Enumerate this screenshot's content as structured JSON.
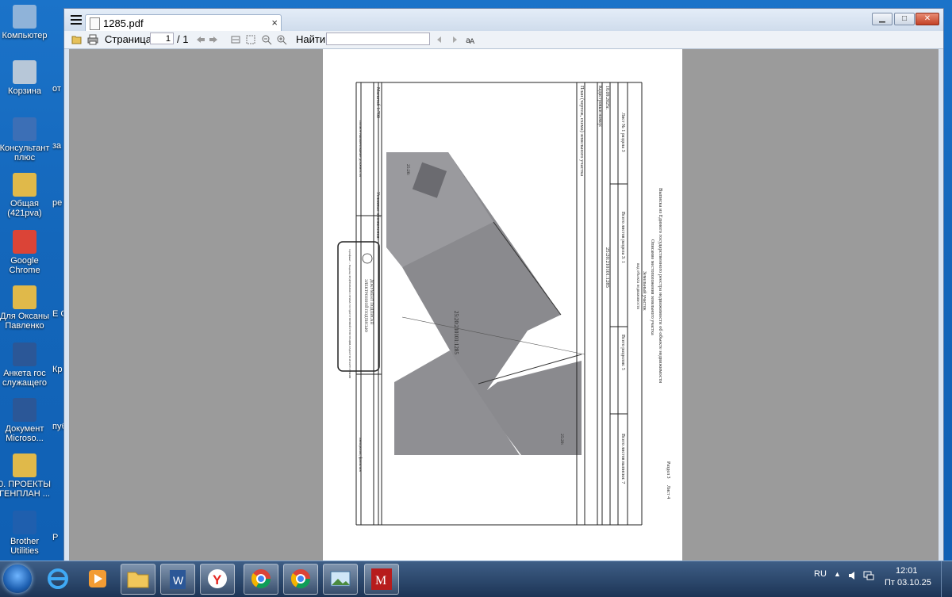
{
  "desktop": {
    "icons": [
      {
        "label": "Компьютер",
        "color": "#8fb3d9"
      },
      {
        "label": "Корзина",
        "color": "#b7c7d8"
      },
      {
        "label": "Консультант плюс",
        "color": "#3c6fb6"
      },
      {
        "label": "Общая (421pva)",
        "color": "#e0b94a"
      },
      {
        "label": "Google Chrome",
        "color": "#db4437"
      },
      {
        "label": "Для Оксаны Павленко",
        "color": "#e0b94a"
      },
      {
        "label": "Анкета гос служащего",
        "color": "#2b5797"
      },
      {
        "label": "Документ Microsо...",
        "color": "#2b5797"
      },
      {
        "label": "0. ПРОЕКТЫ ГЕНПЛАН ...",
        "color": "#e0b94a"
      },
      {
        "label": "Brother Utilities",
        "color": "#1f5fae"
      }
    ],
    "cut_labels": [
      "от",
      "за",
      "ре утв",
      "Е С",
      "Кр",
      "пуб",
      "Р"
    ]
  },
  "window": {
    "menu_icon": "hamburger-icon",
    "tab_title": "1285.pdf",
    "tab_close": "×",
    "minimize": "▁",
    "maximize": "□",
    "close": "✕"
  },
  "toolbar": {
    "page_label": "Страница:",
    "page_current": "1",
    "page_total": "/ 1",
    "find_label": "Найти:",
    "find_value": ""
  },
  "document": {
    "header_line1": "Выписка из Единого государственного реестра недвижимости об объекте недвижимости",
    "header_line2": "Описание местоположения земельного участка",
    "object_type": "Земельный участок",
    "object_type_caption": "вид объекта недвижимости",
    "section_label": "Раздел 3",
    "sheet_label": "Лист 4",
    "cell_sheet_no": "Лист № 1 раздела 3",
    "cell_total_sheets_section": "Всего листов раздела 3: 1",
    "cell_total_sections": "Всего разделов: 5",
    "cell_total_sheets_extract": "Всего листов выписки: 7",
    "date": "18.09.2025г.",
    "cad_label": "Кадастровый номер:",
    "cad_number": "25:20:210101:1285",
    "plan_title": "План (чертеж, схема) земельного участка",
    "scale": "Масштаб 1:700",
    "legend_label": "Условные обозначения:",
    "parcel_label": "25:20:210101:1285",
    "neighbor_top": "25:20:",
    "neighbor_bottom": "25:20:",
    "stamp_line1": "ДОКУМЕНТ ПОДПИСАН",
    "stamp_line2": "ЭЛЕКТРОННОЙ ПОДПИСЬЮ",
    "stamp_small": "Сертификат: ... Владелец: ФЕДЕРАЛЬНАЯ СЛУЖБА ГОСУДАРСТВЕННОЙ РЕГИСТРАЦИИ, КАДАСТРА И КАРТОГРАФИИ",
    "position_caption": "полное наименование должности",
    "signature_caption": "инициалы, фамилия"
  },
  "taskbar": {
    "lang": "RU",
    "time": "12:01",
    "date": "Пт 03.10.25"
  }
}
